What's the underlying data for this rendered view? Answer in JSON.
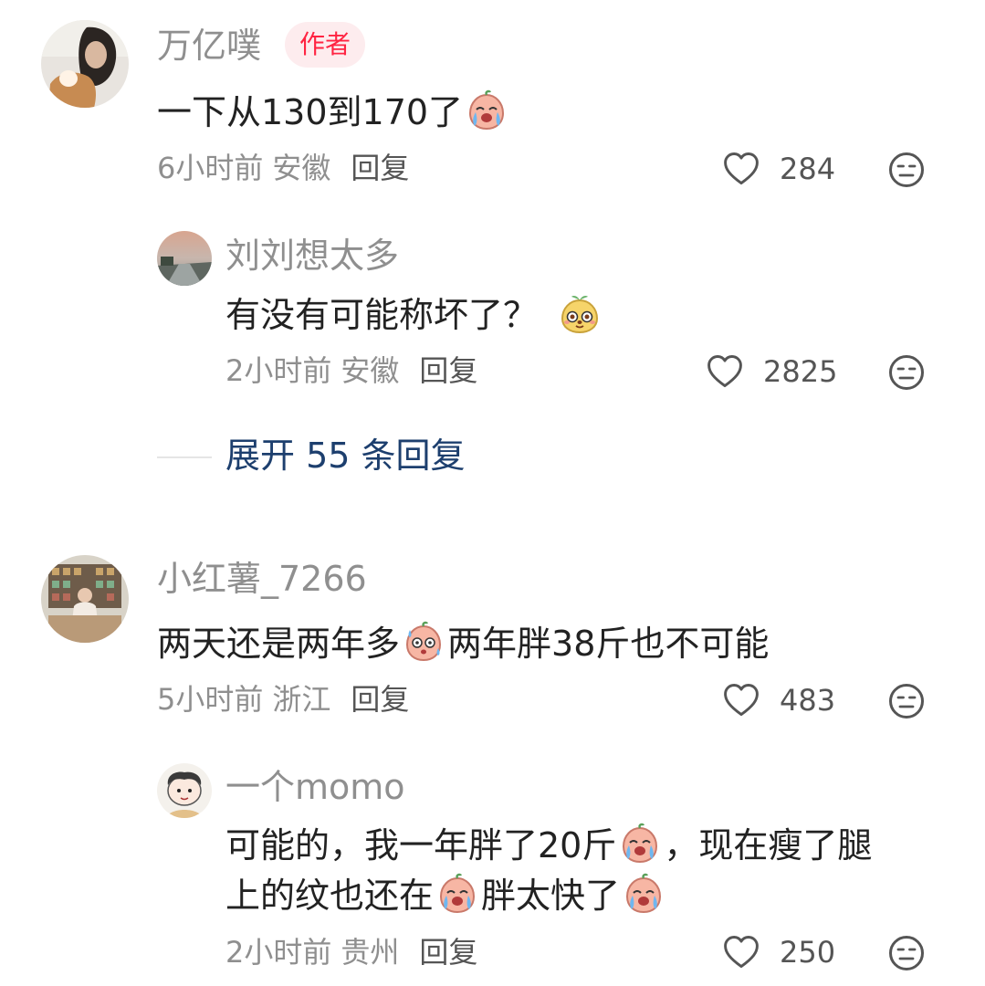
{
  "comments": [
    {
      "user": "万亿噗",
      "badge": "作者",
      "text_before": "一下从130到170了",
      "text_after": "",
      "meta": {
        "time": "6小时前",
        "location": "安徽",
        "reply": "回复"
      },
      "likes": "284",
      "replies": [
        {
          "user": "刘刘想太多",
          "text_before": "有没有可能称坏了？",
          "text_after": "",
          "meta": {
            "time": "2小时前",
            "location": "安徽",
            "reply": "回复"
          },
          "likes": "2825"
        }
      ],
      "expand": "展开 55 条回复"
    },
    {
      "user": "小红薯_7266",
      "text_before": "两天还是两年多",
      "text_after": "两年胖38斤也不可能",
      "meta": {
        "time": "5小时前",
        "location": "浙江",
        "reply": "回复"
      },
      "likes": "483",
      "replies": [
        {
          "user": "一个momo",
          "line1_a": "可能的，我一年胖了20斤",
          "line1_b": "，现在瘦了腿",
          "line2_a": "上的纹也还在",
          "line2_b": "胖太快了",
          "meta": {
            "time": "2小时前",
            "location": "贵州",
            "reply": "回复"
          },
          "likes": "250"
        }
      ]
    }
  ],
  "icons": {
    "like": "heart-outline-icon",
    "meh": "meh-face-icon",
    "emoji_cry": "crying-peach-emoji",
    "emoji_shock": "shocked-peach-emoji",
    "emoji_cute": "cute-sprout-emoji"
  },
  "colors": {
    "author_badge": "#ff2442",
    "expand_link": "#1d3f6e"
  }
}
